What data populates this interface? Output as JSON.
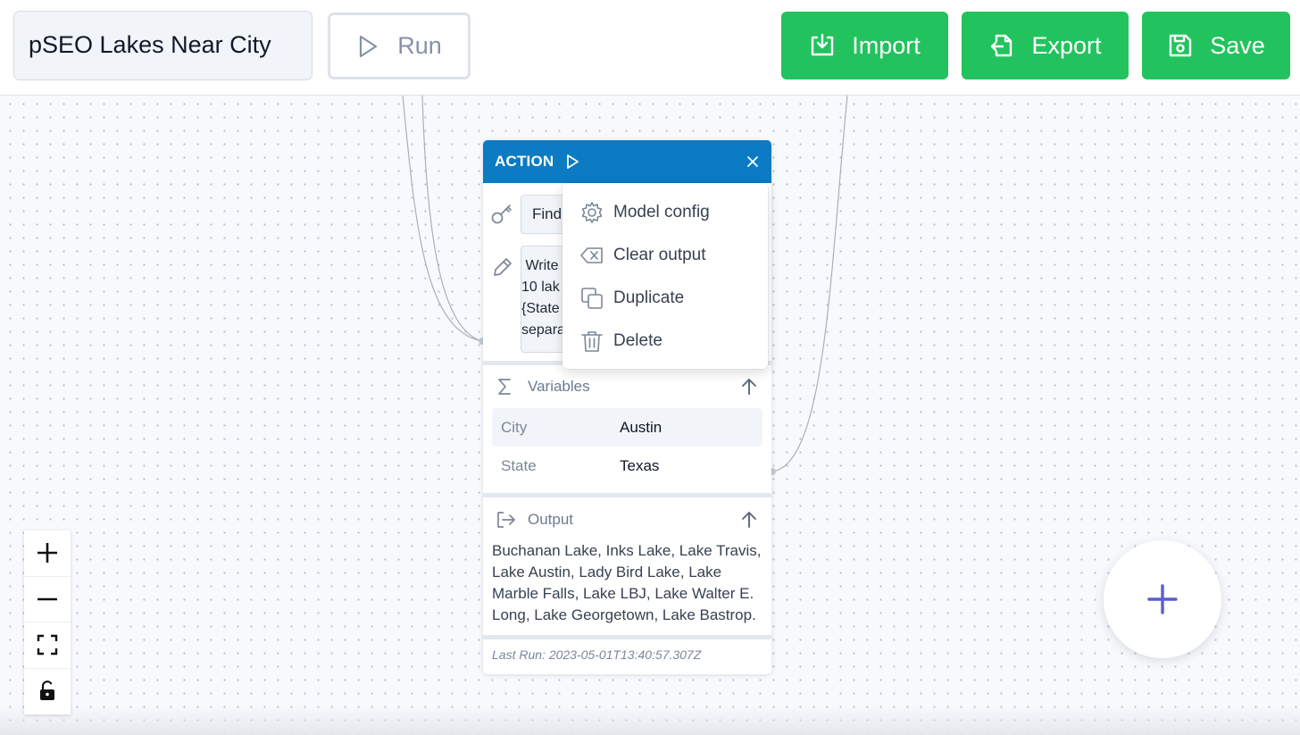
{
  "toolbar": {
    "flow_title": "pSEO Lakes Near City",
    "run_label": "Run",
    "import_label": "Import",
    "export_label": "Export",
    "save_label": "Save"
  },
  "node": {
    "type_label": "ACTION",
    "key_value": "Find",
    "prompt_value": " Write\n10 lak\n{State\nsepara",
    "variables": {
      "label": "Variables",
      "rows": [
        {
          "name": "City",
          "value": "Austin"
        },
        {
          "name": "State",
          "value": "Texas"
        }
      ]
    },
    "output": {
      "label": "Output",
      "text": "Buchanan Lake, Inks Lake, Lake Travis, Lake Austin, Lady Bird Lake, Lake Marble Falls, Lake LBJ, Lake Walter E. Long, Lake Georgetown, Lake Bastrop."
    },
    "last_run": "Last Run: 2023-05-01T13:40:57.307Z"
  },
  "context_menu": {
    "items": [
      {
        "label": "Model config",
        "icon": "gear-icon"
      },
      {
        "label": "Clear output",
        "icon": "backspace-icon"
      },
      {
        "label": "Duplicate",
        "icon": "copy-icon"
      },
      {
        "label": "Delete",
        "icon": "trash-icon"
      }
    ]
  },
  "colors": {
    "accent_green": "#22c35e",
    "node_header_blue": "#0b7bc4",
    "fab_plus_purple": "#5b5bd6"
  }
}
